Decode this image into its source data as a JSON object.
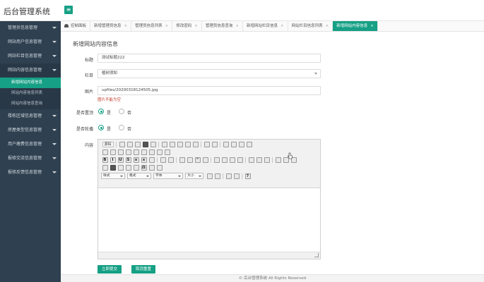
{
  "header": {
    "brand": "后台管理系统",
    "toggle_glyph": "≡"
  },
  "sidebar": {
    "items": [
      {
        "label": "管理员信息管理"
      },
      {
        "label": "网站用户信息管理"
      },
      {
        "label": "网站栏目信息管理"
      },
      {
        "label": "网站内容信息管理",
        "expanded": true,
        "children": [
          "新增网站内容信息",
          "网站内容信息列表",
          "网站内容信息查询"
        ]
      },
      {
        "label": "楼栋区域信息管理"
      },
      {
        "label": "房屋类型信息管理"
      },
      {
        "label": "用户缴费信息管理"
      },
      {
        "label": "报修交流信息管理"
      },
      {
        "label": "报修反馈信息管理"
      }
    ]
  },
  "tabs": [
    "控制面板",
    "新增管理员信息",
    "管理员信息列表",
    "修改密码",
    "管理员信息查询",
    "新增网站栏目信息",
    "网站栏目信息列表",
    "新增网站内容信息"
  ],
  "form": {
    "title": "新增网站内容信息",
    "title_label": "标题",
    "title_value": "测试标题222",
    "column_label": "栏目",
    "column_value": "植树须知",
    "image_label": "图片",
    "image_value": "upfiles/20200318124505.jpg",
    "image_error": "图片不能为空",
    "top_label": "是否置顶",
    "top_yes": "是",
    "top_no": "否",
    "carousel_label": "是否轮播",
    "carousel_yes": "是",
    "carousel_no": "否",
    "content_label": "内容",
    "submit": "立即提交",
    "reset": "取消重置"
  },
  "editor": {
    "source": "源码",
    "combos": [
      "样式",
      "格式",
      "字体",
      "大小"
    ]
  },
  "footer": "© 后台管理系统 All Rights Reserved",
  "colors": {
    "accent": "#16a085",
    "sidebar": "#2f4050",
    "error": "#c0392b"
  }
}
